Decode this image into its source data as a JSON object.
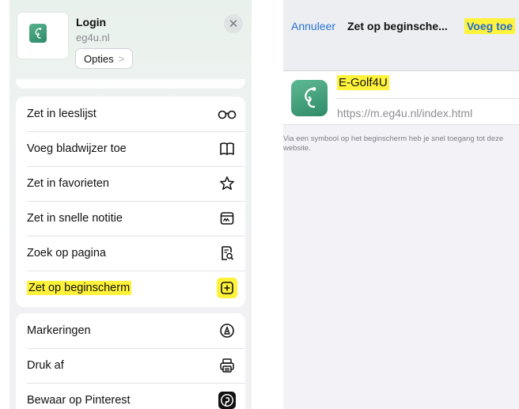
{
  "share_sheet": {
    "site_title": "Login",
    "site_domain": "eg4u.nl",
    "options_label": "Opties",
    "options_chevron": ">",
    "close_glyph": "✕",
    "actions_group1": [
      {
        "label": "Zet in leeslijst",
        "icon": "reading-glasses-icon"
      },
      {
        "label": "Voeg bladwijzer toe",
        "icon": "book-icon"
      },
      {
        "label": "Zet in favorieten",
        "icon": "star-icon"
      },
      {
        "label": "Zet in snelle notitie",
        "icon": "quick-note-icon"
      },
      {
        "label": "Zoek op pagina",
        "icon": "find-on-page-icon"
      },
      {
        "label": "Zet op beginscherm",
        "icon": "add-square-icon",
        "highlighted": true
      }
    ],
    "actions_group2": [
      {
        "label": "Markeringen",
        "icon": "markup-icon"
      },
      {
        "label": "Druk af",
        "icon": "printer-icon"
      },
      {
        "label": "Bewaar op Pinterest",
        "icon": "pinterest-icon"
      }
    ]
  },
  "add_to_home": {
    "cancel_label": "Annuleer",
    "title": "Zet op beginsche...",
    "add_label": "Voeg toe",
    "app_name": "E-Golf4U",
    "url": "https://m.eg4u.nl/index.html",
    "helper_text": "Via een symbool op het beginscherm heb je snel toegang tot deze website."
  },
  "colors": {
    "accent_blue": "#2a72d6",
    "highlight_yellow": "#fff23a",
    "app_green": "#3a9a75"
  }
}
